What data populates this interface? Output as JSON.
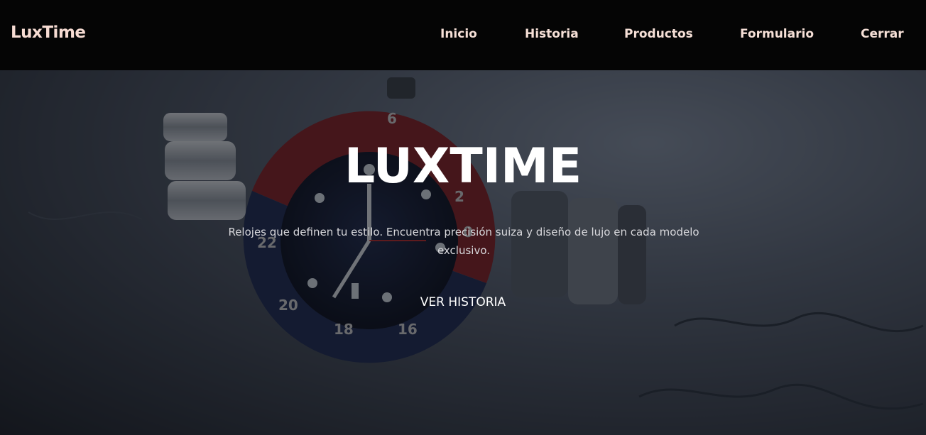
{
  "navbar": {
    "brand": "LuxTime",
    "links": [
      {
        "label": "Inicio"
      },
      {
        "label": "Historia"
      },
      {
        "label": "Productos"
      },
      {
        "label": "Formulario"
      },
      {
        "label": "Cerrar"
      }
    ]
  },
  "hero": {
    "title": "LUXTIME",
    "subtitle": "Relojes que definen tu estilo. Encuentra precisión suiza y diseño de lujo en cada modelo exclusivo.",
    "cta": "VER HISTORIA"
  },
  "bezel_numbers": [
    "6",
    "2",
    "0",
    "22",
    "20",
    "18",
    "16"
  ],
  "colors": {
    "navbar_bg": "#050505",
    "nav_text": "#f6e0d7",
    "bezel_red": "#8a1f24",
    "bezel_blue": "#1d2a55",
    "dial": "#121a33"
  }
}
